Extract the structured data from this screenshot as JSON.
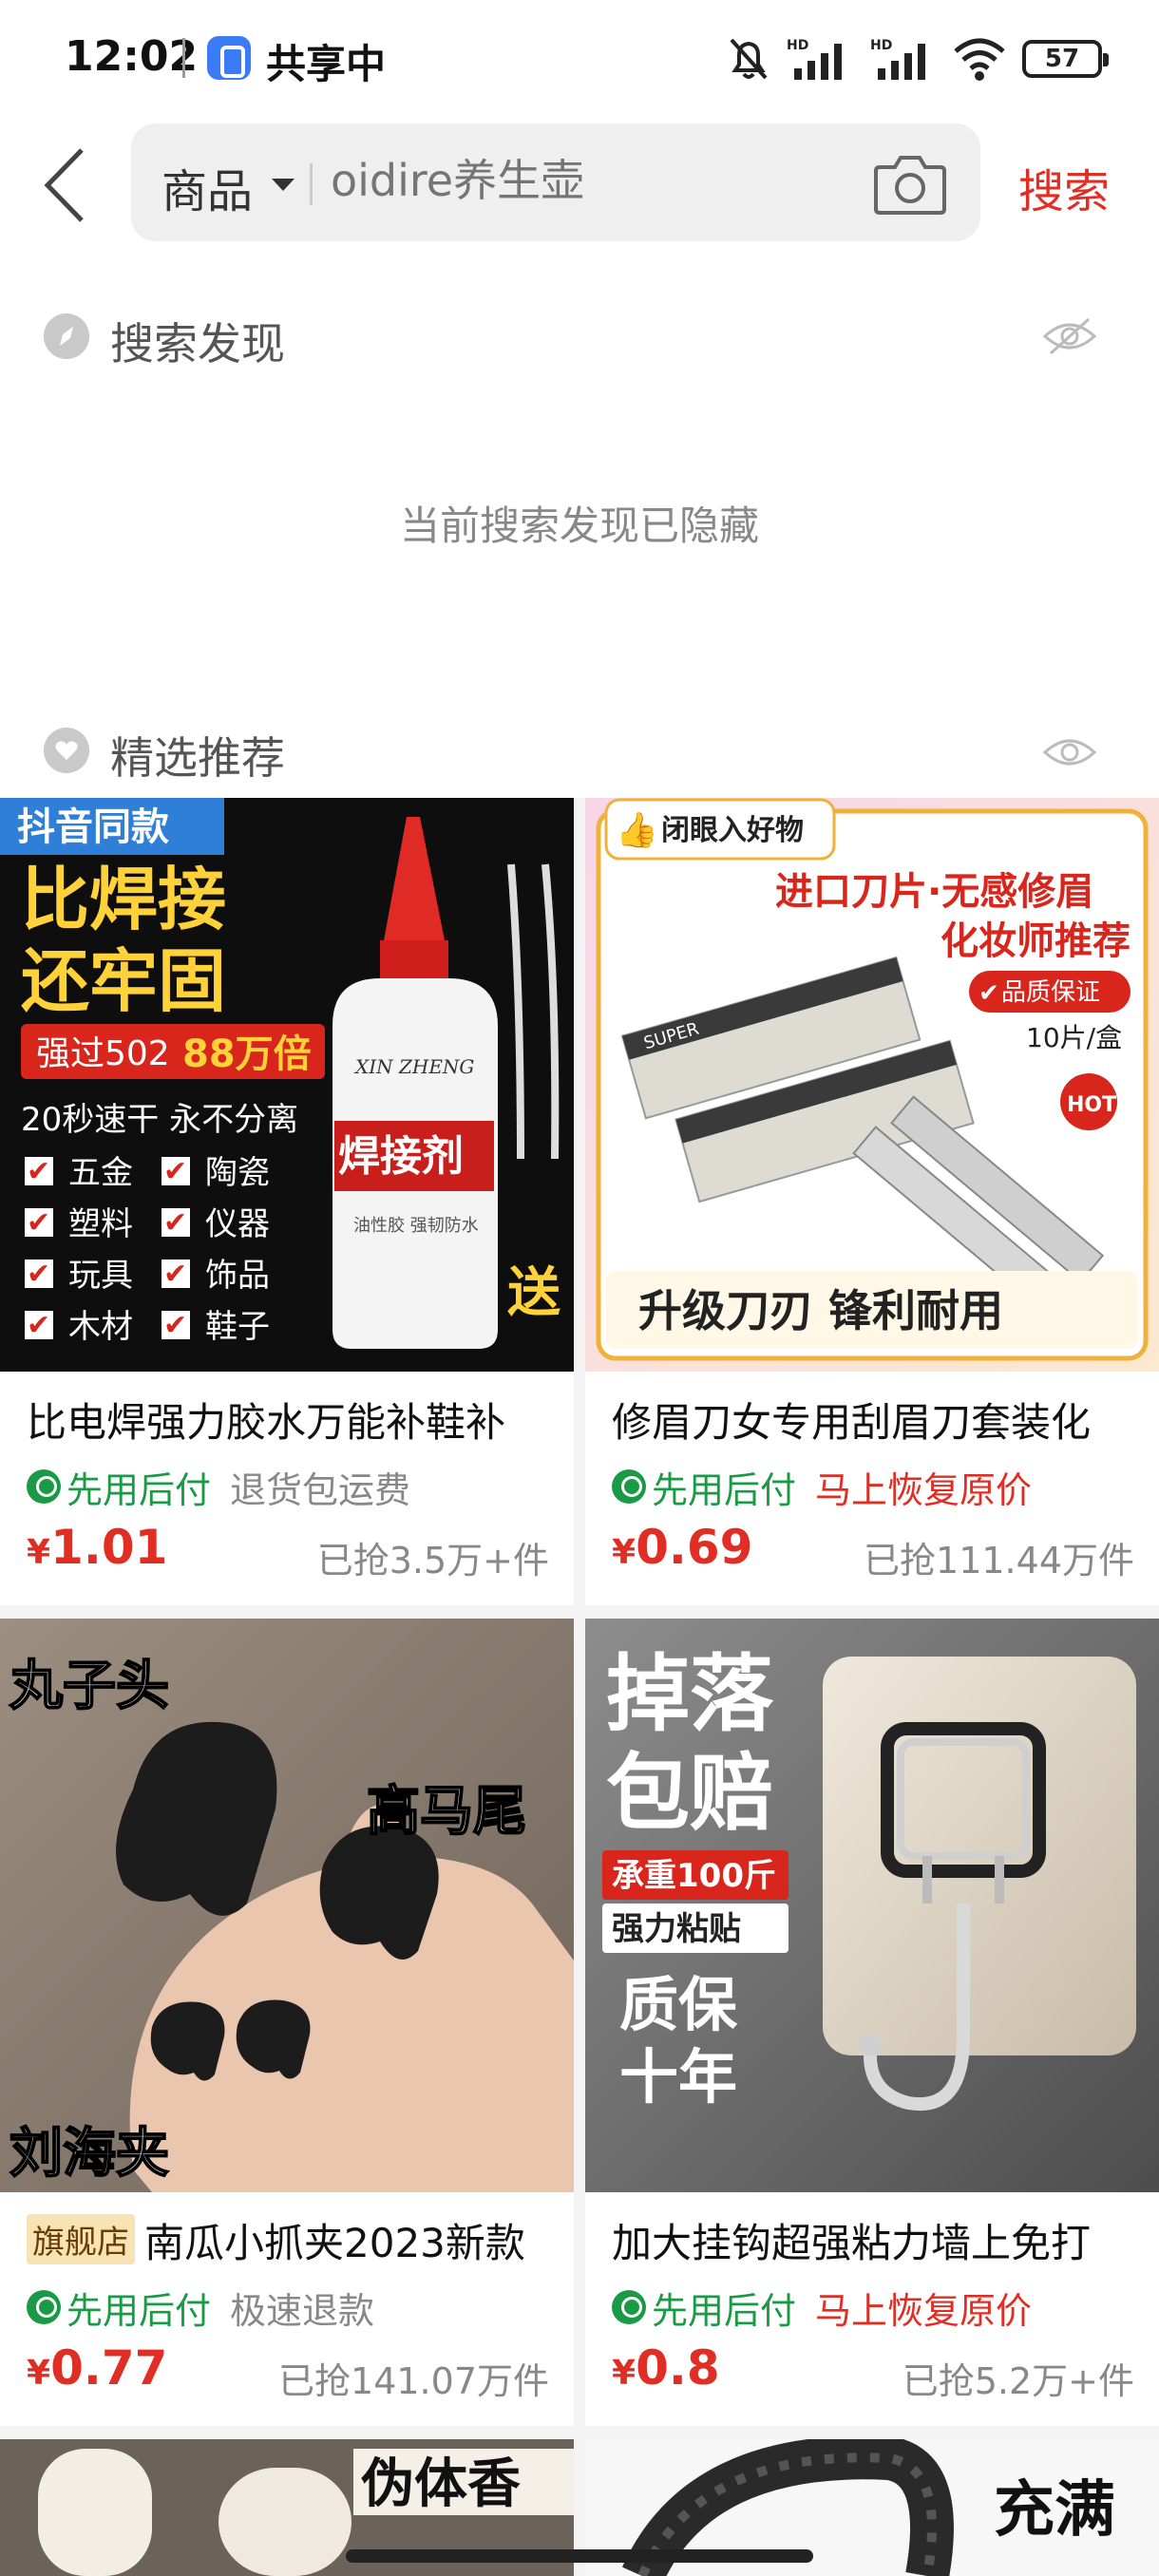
{
  "status_bar": {
    "time": "12:02",
    "sharing_label": "共享中",
    "battery": "57",
    "icons": [
      "share-screen-icon",
      "bell-muted-icon",
      "hd-signal-icon",
      "hd-signal-icon",
      "wifi-icon",
      "battery-icon"
    ]
  },
  "search": {
    "scope": "商品",
    "placeholder": "oidire养生壶",
    "button": "搜索",
    "icons": [
      "back-arrow-icon",
      "caret-down-icon",
      "camera-icon"
    ]
  },
  "discover": {
    "title": "搜索发现",
    "hidden_message": "当前搜索发现已隐藏",
    "icons": [
      "compass-icon",
      "eye-closed-icon"
    ]
  },
  "recommend": {
    "title": "精选推荐",
    "icons": [
      "heart-icon",
      "eye-icon"
    ]
  },
  "products": [
    {
      "title": "比电焊强力胶水万能补鞋补",
      "badge": "",
      "pay_tag": "先用后付",
      "extra_tag": "退货包运费",
      "extra_tag_color": "gray",
      "currency": "¥",
      "price": "1.01",
      "sold": "已抢3.5万+件",
      "image": {
        "corner_tag": "抖音同款",
        "headline1": "比焊接",
        "headline2": "还牢固",
        "banner": "强过502",
        "banner_em": "88万倍",
        "subline": "20秒速干  永不分离",
        "checklist": [
          "五金",
          "陶瓷",
          "塑料",
          "仪器",
          "玩具",
          "饰品",
          "木材",
          "鞋子"
        ],
        "bottle_label": "焊接剂",
        "bottle_brand": "XIN ZHENG",
        "bottle_small": "油性胶  强韧防水",
        "gift": "送"
      }
    },
    {
      "title": "修眉刀女专用刮眉刀套装化",
      "badge": "",
      "pay_tag": "先用后付",
      "extra_tag": "马上恢复原价",
      "extra_tag_color": "red",
      "currency": "¥",
      "price": "0.69",
      "sold": "已抢111.44万件",
      "image": {
        "corner_tag": "闭眼入好物",
        "headline1": "进口刀片·无感修眉",
        "headline2": "化妆师推荐",
        "quality": "品质保证",
        "qty": "10片/盒",
        "hot": "HOT",
        "bottom_banner": "升级刀刃 锋利耐用",
        "box_text": "SUPER"
      }
    },
    {
      "title": "南瓜小抓夹2023新款",
      "badge": "旗舰店",
      "pay_tag": "先用后付",
      "extra_tag": "极速退款",
      "extra_tag_color": "gray",
      "currency": "¥",
      "price": "0.77",
      "sold": "已抢141.07万件",
      "image": {
        "label_tl": "丸子头",
        "label_mr": "高马尾",
        "label_bl": "刘海夹"
      }
    },
    {
      "title": "加大挂钩超强粘力墙上免打",
      "badge": "",
      "pay_tag": "先用后付",
      "extra_tag": "马上恢复原价",
      "extra_tag_color": "red",
      "currency": "¥",
      "price": "0.8",
      "sold": "已抢5.2万+件",
      "image": {
        "headline1": "掉落",
        "headline2": "包赔",
        "banner1": "承重100斤",
        "banner2": "强力粘贴",
        "sub1": "质保",
        "sub2": "十年"
      }
    },
    {
      "image": {
        "headline": "伪体香"
      }
    },
    {
      "image": {
        "headline": "充满"
      }
    }
  ]
}
